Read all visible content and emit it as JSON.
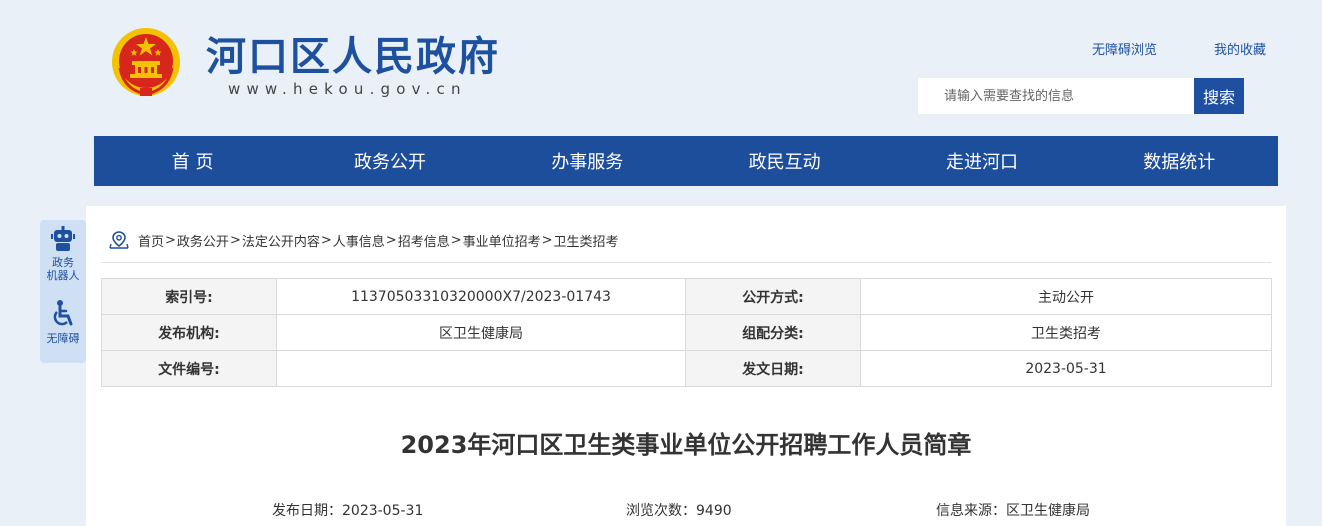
{
  "header": {
    "site_title": "河口区人民政府",
    "site_url": "www.hekou.gov.cn",
    "links": [
      "无障碍浏览",
      "我的收藏"
    ],
    "search": {
      "placeholder": "请输入需要查找的信息",
      "button_label": "搜索"
    }
  },
  "nav": [
    "首 页",
    "政务公开",
    "办事服务",
    "政民互动",
    "走进河口",
    "数据统计"
  ],
  "float_bar": {
    "robot_label_1": "政务",
    "robot_label_2": "机器人",
    "accessibility_label": "无障碍"
  },
  "breadcrumb": [
    "首页",
    "政务公开",
    "法定公开内容",
    "人事信息",
    "招考信息",
    "事业单位招考",
    "卫生类招考"
  ],
  "breadcrumb_sep": ">",
  "meta": {
    "index_no_key": "索引号:",
    "index_no": "11370503310320000X7/2023-01743",
    "disclose_key": "公开方式:",
    "disclose": "主动公开",
    "publisher_key": "发布机构:",
    "publisher": "区卫生健康局",
    "category_key": "组配分类:",
    "category": "卫生类招考",
    "doc_no_key": "文件编号:",
    "doc_no": "",
    "issue_date_key": "发文日期:",
    "issue_date": "2023-05-31"
  },
  "article": {
    "title": "2023年河口区卫生类事业单位公开招聘工作人员简章",
    "publish_date": "发布日期：2023-05-31",
    "views": "浏览次数：9490",
    "source": "信息来源：区卫生健康局"
  },
  "colors": {
    "brand_blue": "#1d4e9c",
    "page_bg": "#e9f0f8",
    "emblem_red": "#d7261c",
    "emblem_gold": "#f3c200"
  }
}
